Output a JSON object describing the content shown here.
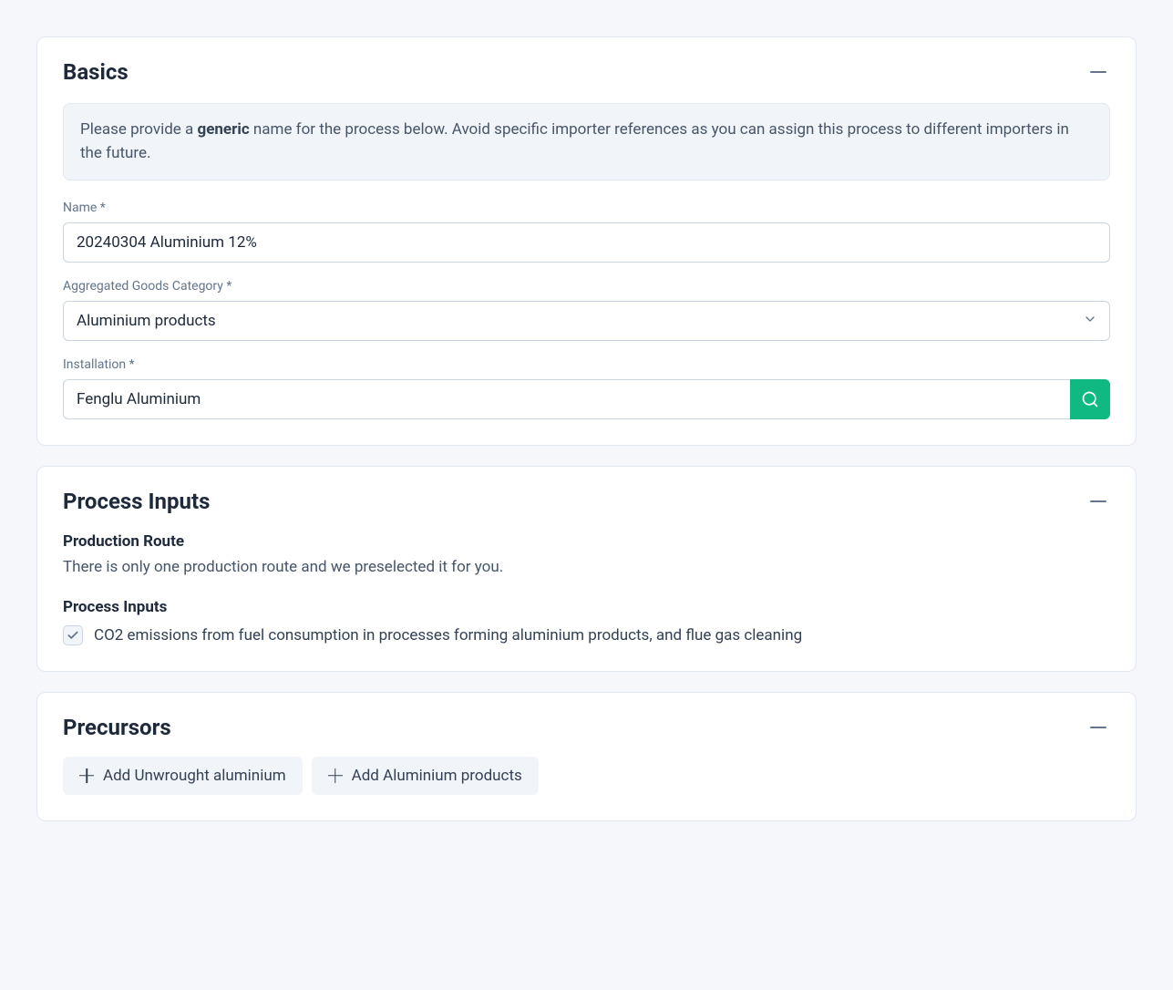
{
  "basics": {
    "title": "Basics",
    "info_prefix": "Please provide a ",
    "info_bold": "generic",
    "info_suffix": " name for the process below. Avoid specific importer references as you can assign this process to different importers in the future.",
    "name_label": "Name *",
    "name_value": "20240304 Aluminium 12%",
    "category_label": "Aggregated Goods Category *",
    "category_value": "Aluminium products",
    "installation_label": "Installation *",
    "installation_value": "Fenglu Aluminium"
  },
  "process_inputs": {
    "title": "Process Inputs",
    "route_title": "Production Route",
    "route_text": "There is only one production route and we preselected it for you.",
    "inputs_title": "Process Inputs",
    "checkbox_label": "CO2 emissions from fuel consumption in processes forming aluminium products, and flue gas cleaning"
  },
  "precursors": {
    "title": "Precursors",
    "add_unwrought": "Add Unwrought aluminium",
    "add_products": "Add Aluminium products"
  }
}
